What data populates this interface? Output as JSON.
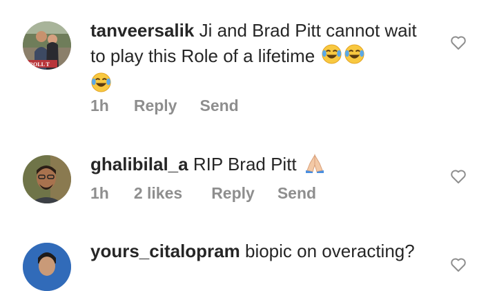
{
  "comments": [
    {
      "username": "tanveersalik",
      "text": "Ji and Brad Pitt cannot wait to play this Role of a lifetime",
      "emojis": [
        "face-with-tears-of-joy-icon",
        "face-with-tears-of-joy-icon",
        "face-with-tears-of-joy-icon"
      ],
      "time": "1h",
      "likes": "",
      "reply_label": "Reply",
      "send_label": "Send",
      "avatar_banner_text": "ROLL T"
    },
    {
      "username": "ghalibilal_a",
      "text": "RIP Brad Pitt",
      "emojis": [
        "folded-hands-icon"
      ],
      "time": "1h",
      "likes": "2 likes",
      "reply_label": "Reply",
      "send_label": "Send"
    },
    {
      "username": "yours_citalopram",
      "text": "biopic on overacting?",
      "emojis": []
    }
  ],
  "colors": {
    "text": "#262626",
    "meta": "#8e8e8e",
    "heart_stroke": "#8e8e8e"
  }
}
